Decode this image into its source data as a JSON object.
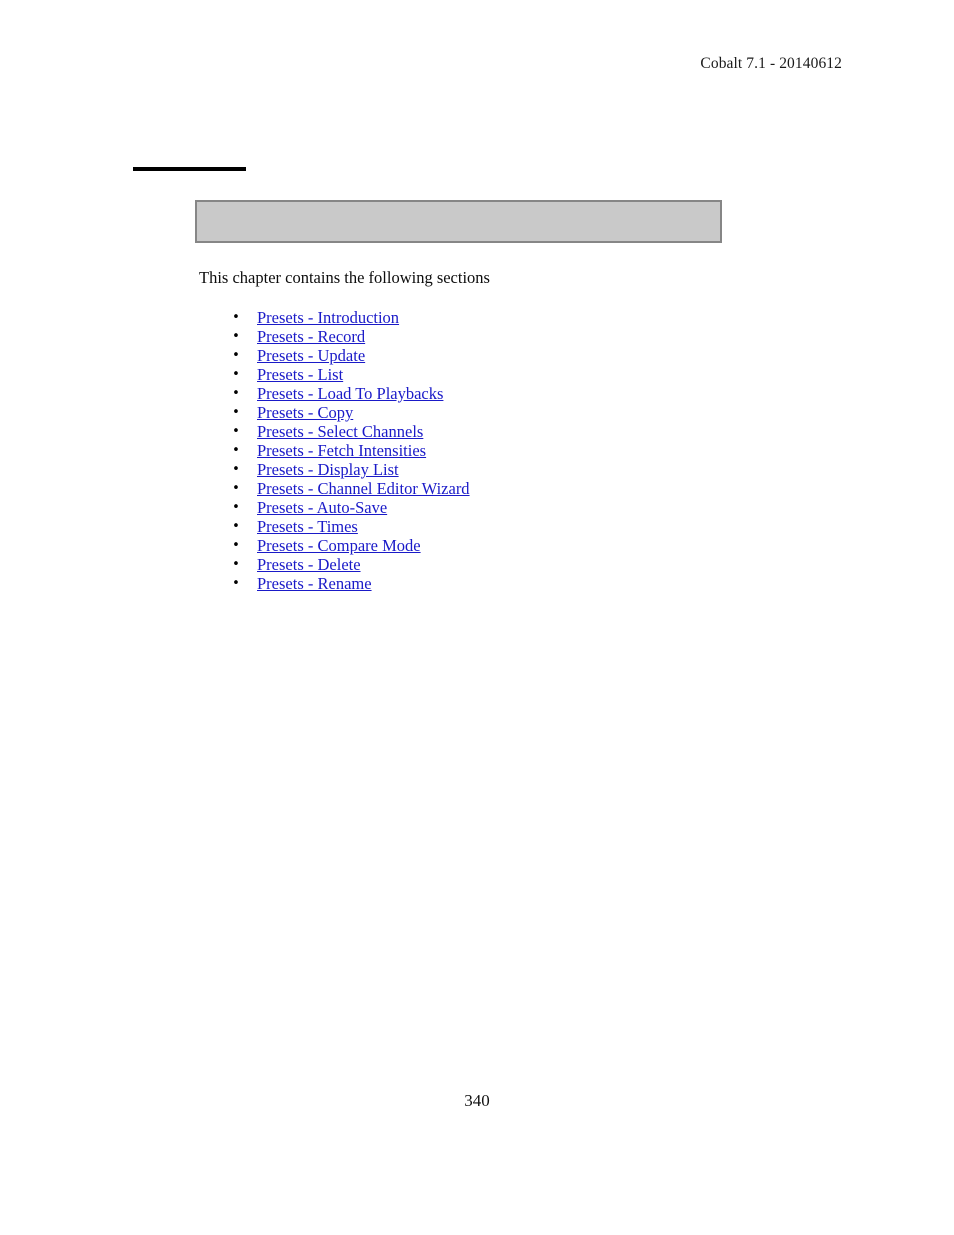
{
  "document": {
    "running_header": "Cobalt 7.1 - 20140612",
    "chapter_title": "",
    "banner_label": "",
    "intro_text": "This chapter contains the following sections",
    "page_number": "340",
    "bullet_glyph": "•",
    "colors": {
      "link": "#1a1ac8",
      "text": "#000000",
      "banner_fill": "#c9c9c9",
      "banner_border": "#868686",
      "rule": "#000000",
      "page_background": "#ffffff"
    }
  },
  "toc": {
    "links": [
      {
        "label": "Presets - Introduction"
      },
      {
        "label": "Presets - Record"
      },
      {
        "label": "Presets - Update"
      },
      {
        "label": "Presets - List"
      },
      {
        "label": "Presets - Load To Playbacks"
      },
      {
        "label": "Presets - Copy"
      },
      {
        "label": "Presets - Select Channels"
      },
      {
        "label": "Presets - Fetch Intensities"
      },
      {
        "label": "Presets - Display List"
      },
      {
        "label": "Presets - Channel Editor Wizard"
      },
      {
        "label": "Presets - Auto-Save"
      },
      {
        "label": "Presets - Times"
      },
      {
        "label": "Presets - Compare Mode"
      },
      {
        "label": "Presets - Delete"
      },
      {
        "label": "Presets - Rename"
      }
    ]
  }
}
